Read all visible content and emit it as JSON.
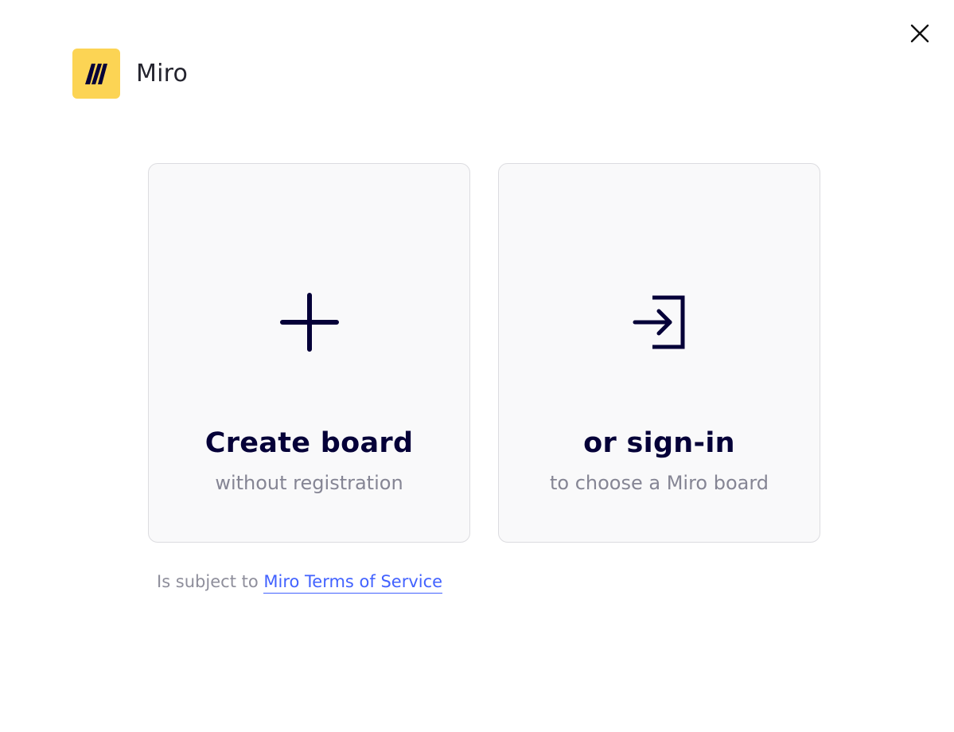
{
  "header": {
    "app_name": "Miro",
    "logo_icon": "miro-logo-icon",
    "logo_color": "#fcd454"
  },
  "window": {
    "close_icon": "close-icon"
  },
  "cards": {
    "create": {
      "icon": "plus-icon",
      "title": "Create board",
      "subtitle": "without registration"
    },
    "signin": {
      "icon": "sign-in-icon",
      "title": "or sign-in",
      "subtitle": "to choose a Miro board"
    }
  },
  "footer": {
    "prefix": "Is subject to",
    "link_text": "Miro Terms of Service",
    "link_color": "#4262ff"
  },
  "colors": {
    "primary_text": "#050038",
    "secondary_text": "#858594",
    "card_background": "#f9f9fa"
  }
}
